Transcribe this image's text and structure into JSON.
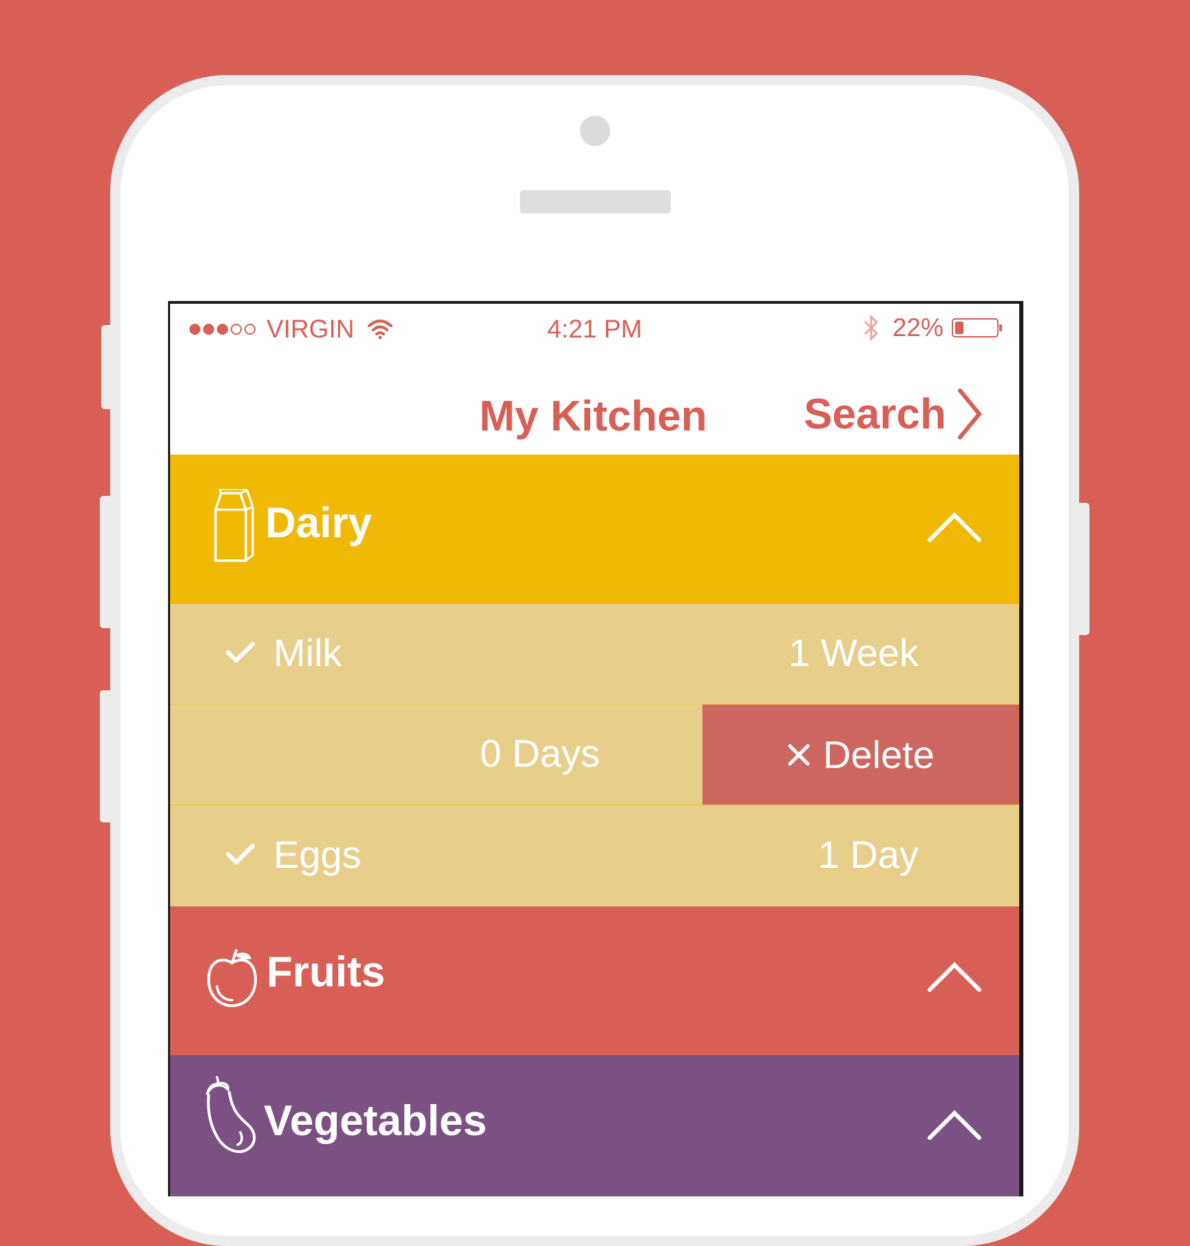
{
  "status_bar": {
    "carrier": "VIRGIN",
    "time": "4:21 PM",
    "battery": "22%",
    "battery_level": 0.22,
    "signal_bars_filled": 3,
    "signal_bars_total": 5
  },
  "nav": {
    "title": "My Kitchen",
    "search_label": "Search"
  },
  "sections": [
    {
      "name": "Dairy",
      "color": "#f0b905",
      "icon": "milk-carton-icon",
      "items": [
        {
          "name": "Milk",
          "time_left": "1 Week",
          "checked": true
        },
        {
          "name": "",
          "time_left": "0 Days",
          "swiped": true,
          "delete_label": "Delete"
        },
        {
          "name": "Eggs",
          "time_left": "1 Day",
          "checked": true
        }
      ]
    },
    {
      "name": "Fruits",
      "color": "#d75f56",
      "icon": "apple-icon"
    },
    {
      "name": "Vegetables",
      "color": "#7b5183",
      "icon": "eggplant-icon"
    }
  ],
  "colors": {
    "background": "#d75f56",
    "accent": "#d75f56",
    "item_row": "#e7cf8b",
    "delete": "#cc665f"
  }
}
